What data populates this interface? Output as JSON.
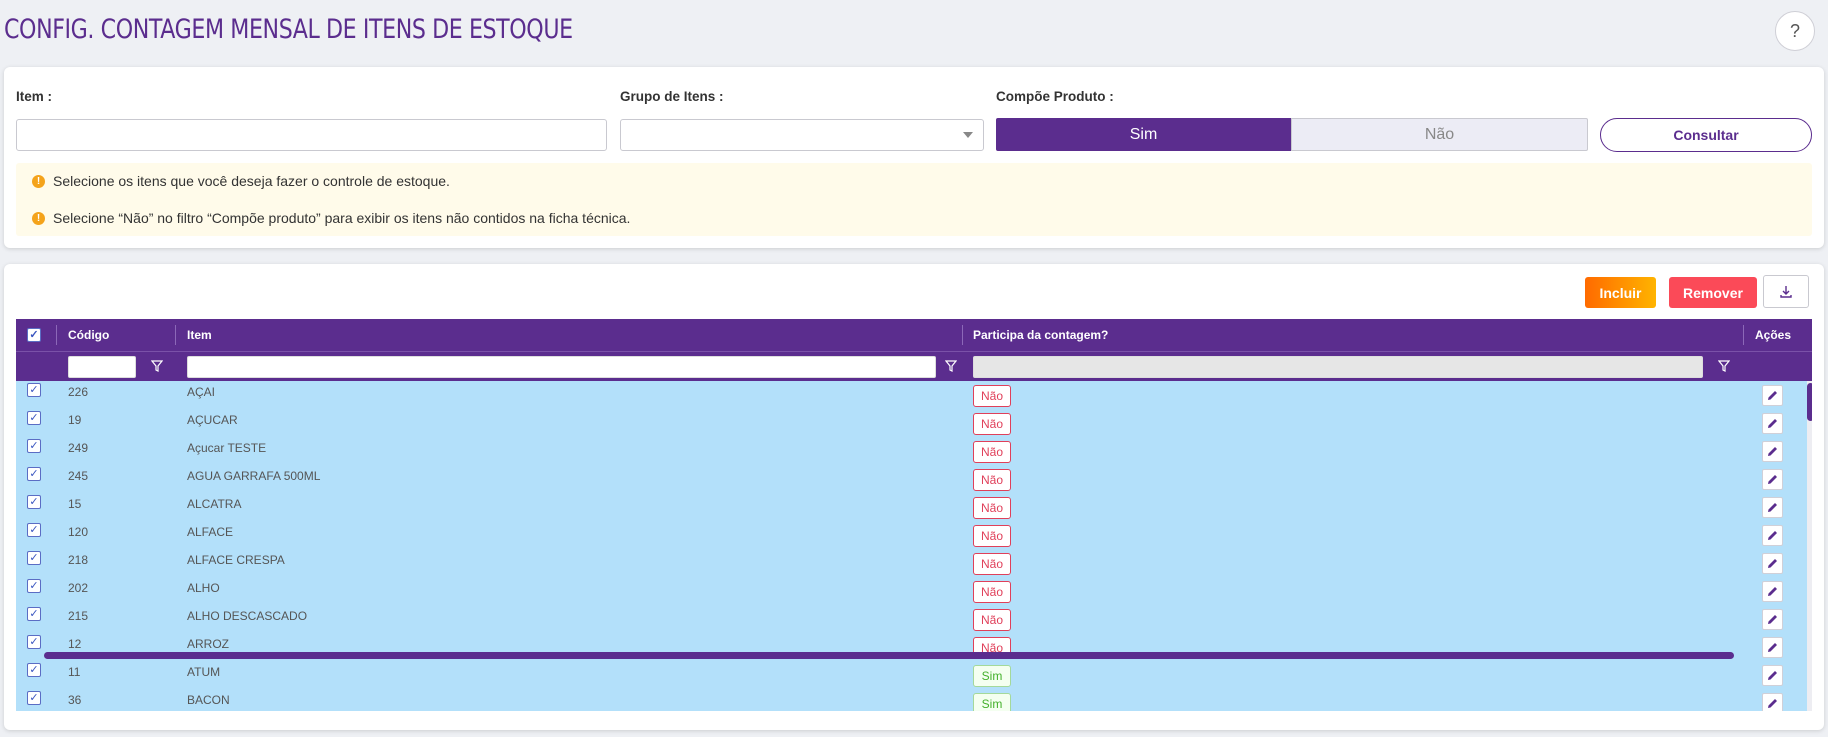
{
  "page": {
    "title": "CONFIG. CONTAGEM MENSAL DE ITENS DE ESTOQUE",
    "help_label": "?"
  },
  "filters": {
    "item_label": "Item :",
    "item_value": "",
    "group_label": "Grupo de Itens :",
    "group_value": "",
    "compoe_label": "Compõe Produto :",
    "toggle_yes": "Sim",
    "toggle_no": "Não",
    "toggle_selected": "Sim",
    "consult_label": "Consultar"
  },
  "notices": [
    "Selecione os itens que você deseja fazer o controle de estoque.",
    "Selecione “Não” no filtro “Compõe produto” para exibir os itens não contidos na ficha técnica."
  ],
  "toolbar": {
    "include_label": "Incluir",
    "remove_label": "Remover",
    "export_icon": "download-icon"
  },
  "grid": {
    "columns": {
      "code": "Código",
      "item": "Item",
      "participa": "Participa da contagem?",
      "actions": "Ações"
    },
    "rows": [
      {
        "code": "226",
        "item": "AÇAI",
        "participa": "Não"
      },
      {
        "code": "19",
        "item": "AÇUCAR",
        "participa": "Não"
      },
      {
        "code": "249",
        "item": "Açucar TESTE",
        "participa": "Não"
      },
      {
        "code": "245",
        "item": "AGUA GARRAFA 500ML",
        "participa": "Não"
      },
      {
        "code": "15",
        "item": "ALCATRA",
        "participa": "Não"
      },
      {
        "code": "120",
        "item": "ALFACE",
        "participa": "Não"
      },
      {
        "code": "218",
        "item": "ALFACE CRESPA",
        "participa": "Não"
      },
      {
        "code": "202",
        "item": "ALHO",
        "participa": "Não"
      },
      {
        "code": "215",
        "item": "ALHO DESCASCADO",
        "participa": "Não"
      },
      {
        "code": "12",
        "item": "ARROZ",
        "participa": "Não"
      },
      {
        "code": "11",
        "item": "ATUM",
        "participa": "Sim"
      },
      {
        "code": "36",
        "item": "BACON",
        "participa": "Sim"
      }
    ]
  },
  "colors": {
    "primary": "#5b2d8e",
    "row_selected": "#b3e0fa",
    "notice_bg": "#fffbea",
    "warn": "#f4a31b",
    "danger": "#fb4a58"
  }
}
